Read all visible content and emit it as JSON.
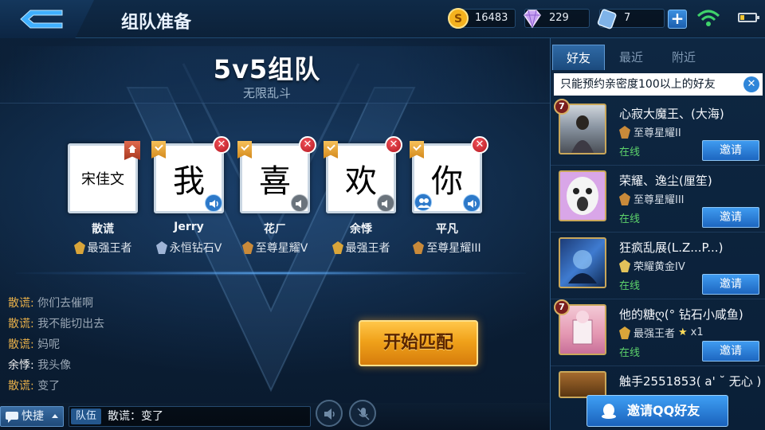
{
  "header": {
    "title": "组队准备",
    "gold": "16483",
    "gems": "229",
    "tickets": "7",
    "icons": [
      "back-icon",
      "gold-coin-icon",
      "diamond-icon",
      "ticket-icon",
      "plus-icon",
      "wifi-icon",
      "battery-icon"
    ]
  },
  "mode": {
    "title": "5v5组队",
    "subtitle": "无限乱斗"
  },
  "slots": [
    {
      "card_text": "宋佳文",
      "name": "散谎",
      "rank": "最强王者"
    },
    {
      "card_text": "我",
      "name": "Jerry",
      "rank": "永恒钻石V"
    },
    {
      "card_text": "喜",
      "name": "花ㄏ",
      "rank": "至尊星耀V"
    },
    {
      "card_text": "欢",
      "name": "余悸",
      "rank": "最强王者"
    },
    {
      "card_text": "你",
      "name": "平凡",
      "rank": "至尊星耀III"
    }
  ],
  "chat": [
    {
      "author": "散谎:",
      "text": "你们去催啊"
    },
    {
      "author": "散谎:",
      "text": "我不能切出去"
    },
    {
      "author": "散谎:",
      "text": "妈呢"
    },
    {
      "author": "余悸:",
      "text": "我头像"
    },
    {
      "author": "散谎:",
      "text": "变了"
    }
  ],
  "start_button": "开始匹配",
  "bottom": {
    "quick_label": "快捷",
    "team_tag": "队伍",
    "input_text": "散谎：变了"
  },
  "friends_panel": {
    "tabs": [
      "好友",
      "最近",
      "附近"
    ],
    "active_tab": "好友",
    "notice": "只能预约亲密度100以上的好友",
    "friends": [
      {
        "name": "心寂大魔王、(大海)",
        "rank": "至尊星耀II",
        "status": "在线",
        "level": "7",
        "invite": "邀请",
        "extra": ""
      },
      {
        "name": "荣耀、逸尘(厘笙)",
        "rank": "至尊星耀III",
        "status": "在线",
        "level": "",
        "invite": "邀请",
        "extra": ""
      },
      {
        "name": "狂疯乱展(L.Z...P...)",
        "rank": "荣耀黄金IV",
        "status": "在线",
        "level": "",
        "invite": "邀请",
        "extra": ""
      },
      {
        "name": "他的糖ღ(° 钻石小咸鱼)",
        "rank": "最强王者",
        "status": "在线",
        "level": "7",
        "invite": "邀请",
        "extra": "x1"
      },
      {
        "name": "触手2551853( a' ˘  无心 )",
        "rank": "",
        "status": "",
        "level": "",
        "invite": "",
        "extra": ""
      }
    ],
    "qq_invite": "邀请QQ好友"
  },
  "colors": {
    "accent_blue": "#2f86d9",
    "gold_author": "#e8b04a",
    "online_green": "#5dd26b",
    "start_orange": "#f0a21a"
  }
}
